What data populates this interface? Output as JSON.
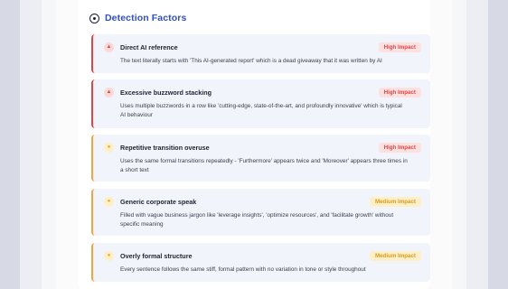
{
  "section": {
    "title": "Detection Factors",
    "icon": "eye-icon"
  },
  "factors": [
    {
      "title": "Direct AI reference",
      "impact": "High Impact",
      "level": "high",
      "icon": "warning-icon",
      "description": "The text literally starts with 'This AI-generated report' which is a dead giveaway that it was written by AI"
    },
    {
      "title": "Excessive buzzword stacking",
      "impact": "High Impact",
      "level": "high",
      "icon": "warning-icon",
      "description": "Uses multiple buzzwords in a row like 'cutting-edge, state-of-the-art, and profoundly innovative' which is typical AI behaviour"
    },
    {
      "title": "Repetitive transition overuse",
      "impact": "High Impact",
      "level": "high",
      "icon": "circle-icon",
      "description": "Uses the same formal transitions repeatedly - 'Furthermore' appears twice and 'Moreover' appears three times in a short text"
    },
    {
      "title": "Generic corporate speak",
      "impact": "Medium Impact",
      "level": "medium",
      "icon": "circle-icon",
      "description": "Filled with vague business jargon like 'leverage insights', 'optimize resources', and 'facilitate growth' without specific meaning"
    },
    {
      "title": "Overly formal structure",
      "impact": "Medium Impact",
      "level": "medium",
      "icon": "circle-icon",
      "description": "Every sentence follows the same stiff, formal pattern with no variation in tone or style throughout"
    }
  ],
  "colors": {
    "accent": "#2f4fc4",
    "high": "#e04646",
    "medium": "#f0a640"
  }
}
